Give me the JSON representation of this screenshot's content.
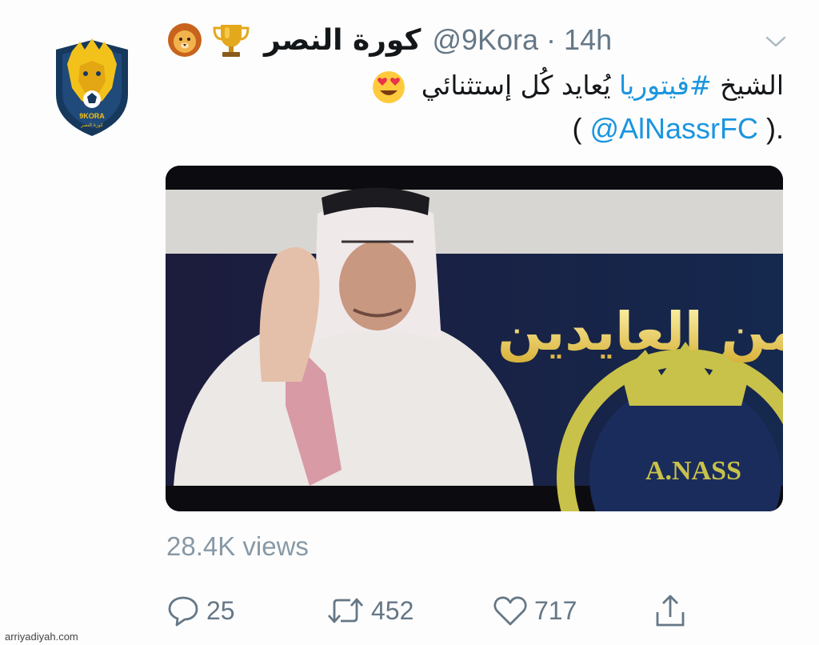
{
  "tweet": {
    "display_name": "كورة النصر",
    "handle": "@9Kora",
    "timestamp": "14h",
    "text_prefix": "الشيخ ",
    "hashtag": "#فيتوريا",
    "text_rest": " يُعايد كُل إستثنائي",
    "mention": "@AlNassrFC",
    "open_paren": "( ",
    "close_paren": " ).",
    "views": "28.4K views"
  },
  "actions": {
    "reply_count": "25",
    "retweet_count": "452",
    "like_count": "717"
  },
  "media": {
    "calligraphy": "من العايدين",
    "crest_text": "A.NASS"
  },
  "avatar": {
    "logo_text": "9KORA",
    "logo_subtext": "كورة النصر"
  },
  "watermark": "arriyadiyah.com",
  "icons": [
    "lion-emoji-icon",
    "trophy-emoji-icon",
    "heart-eyes-emoji-icon",
    "chevron-down-icon",
    "reply-icon",
    "retweet-icon",
    "like-icon",
    "share-icon"
  ],
  "colors": {
    "link": "#1b95e0",
    "muted": "#657786",
    "views": "#8899a6"
  }
}
